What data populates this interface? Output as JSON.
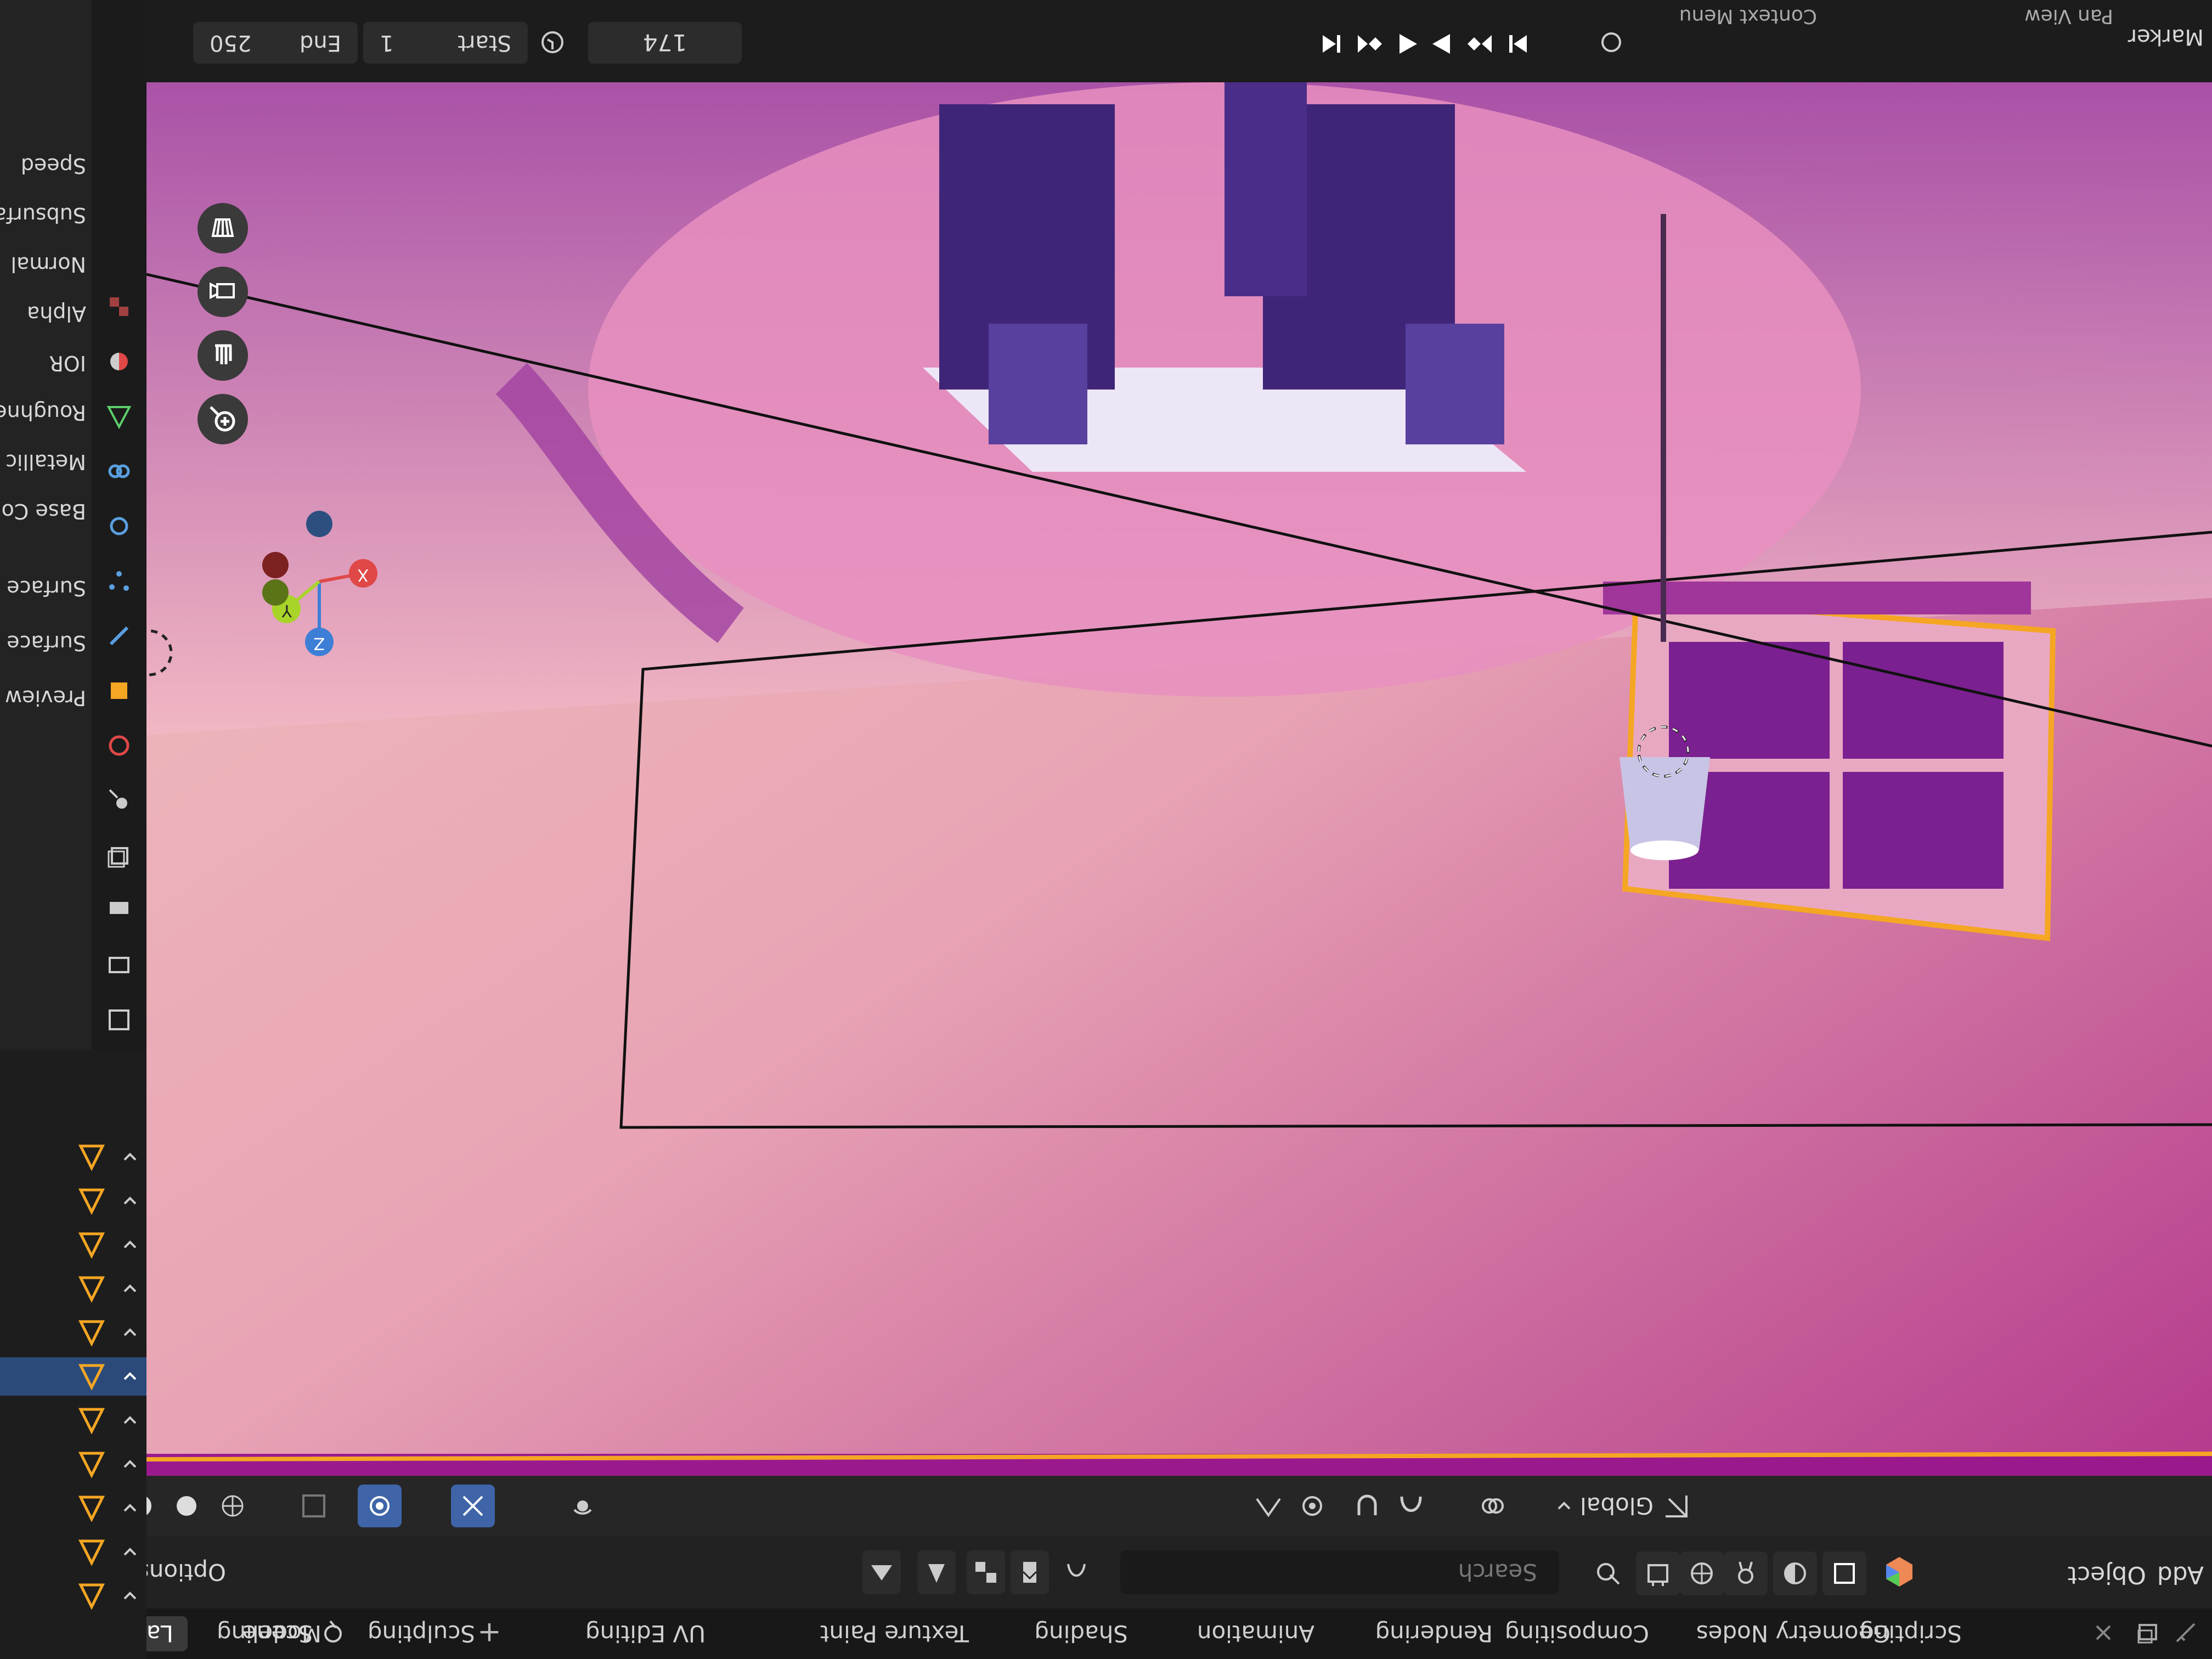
{
  "workspace_tabs": [
    "Layout",
    "Modeling",
    "Sculpting",
    "UV Editing",
    "Texture Paint",
    "Shading",
    "Animation",
    "Rendering",
    "Compositing",
    "Geometry Nodes",
    "Scripting"
  ],
  "scene_label": "Scene",
  "header": {
    "mode_partial": "Object",
    "add_menu": "Add",
    "orientation": "Global",
    "search_placeholder": "Search",
    "options_label": "Options"
  },
  "timeline": {
    "current_frame": "174",
    "start_label": "Start",
    "start_value": "1",
    "end_label": "End",
    "end_value": "250",
    "marker_menu": "Marker",
    "view_menu": "Pan View",
    "context_menu": "Context Menu"
  },
  "properties_partial": [
    "Speed",
    "Subsurface",
    "Normal",
    "Alpha",
    "IOR",
    "Roughness",
    "Metallic",
    "Base Color",
    "Surface",
    "Surface",
    "Preview"
  ],
  "colors": {
    "accent": "#3f65a8",
    "selection_orange": "#f5a623",
    "axis_x": "#e04848",
    "axis_y": "#a8d42a",
    "axis_z": "#3d7fd6"
  },
  "gizmo_axes": [
    "X",
    "Y",
    "Z"
  ]
}
